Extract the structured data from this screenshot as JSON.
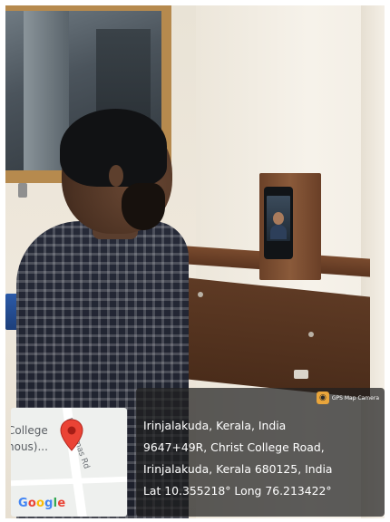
{
  "badge": {
    "label": "GPS Map Camera",
    "icon": "map-camera-icon"
  },
  "location": {
    "place": "Irinjalakuda, Kerala, India",
    "address_line_1": "9647+49R, Christ College Road,",
    "address_line_2": "Irinjalakuda, Kerala 680125, India",
    "coordinates": "Lat 10.355218° Long 76.213422°"
  },
  "map": {
    "label_line_1": "College",
    "label_line_2": "hous)...",
    "road_label": "Fr Dismas Rd",
    "brand": [
      "G",
      "o",
      "o",
      "g",
      "l",
      "e"
    ],
    "pin_color": "#ea4335"
  }
}
